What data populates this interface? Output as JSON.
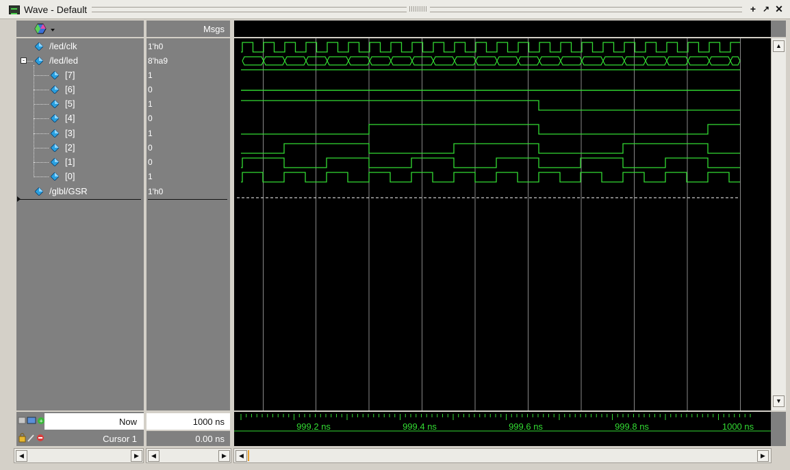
{
  "window": {
    "title": "Wave - Default"
  },
  "header": {
    "msgs_label": "Msgs"
  },
  "signals": [
    {
      "name": "/led/clk",
      "value": "1'h0",
      "level": 0
    },
    {
      "name": "/led/led",
      "value": "8'ha9",
      "level": 0,
      "expanded": true
    },
    {
      "name": "[7]",
      "value": "1",
      "level": 1
    },
    {
      "name": "[6]",
      "value": "0",
      "level": 1
    },
    {
      "name": "[5]",
      "value": "1",
      "level": 1
    },
    {
      "name": "[4]",
      "value": "0",
      "level": 1
    },
    {
      "name": "[3]",
      "value": "1",
      "level": 1
    },
    {
      "name": "[2]",
      "value": "0",
      "level": 1
    },
    {
      "name": "[1]",
      "value": "0",
      "level": 1
    },
    {
      "name": "[0]",
      "value": "1",
      "level": 1
    },
    {
      "name": "/glbl/GSR",
      "value": "1'h0",
      "level": 0
    }
  ],
  "status": {
    "now_label": "Now",
    "now_value": "1000 ns",
    "cursor_label": "Cursor 1",
    "cursor_value": "0.00 ns"
  },
  "timeline": {
    "labels": [
      "999.2 ns",
      "999.4 ns",
      "999.6 ns",
      "999.8 ns",
      "1000 ns"
    ]
  },
  "colors": {
    "waveform": "#33dd33",
    "background": "#000000",
    "grid": "#808080",
    "diamond": "#2aa0e0"
  },
  "icons": {
    "toolbar": "wave-tools-icon",
    "signal": "signal-diamond-icon"
  }
}
